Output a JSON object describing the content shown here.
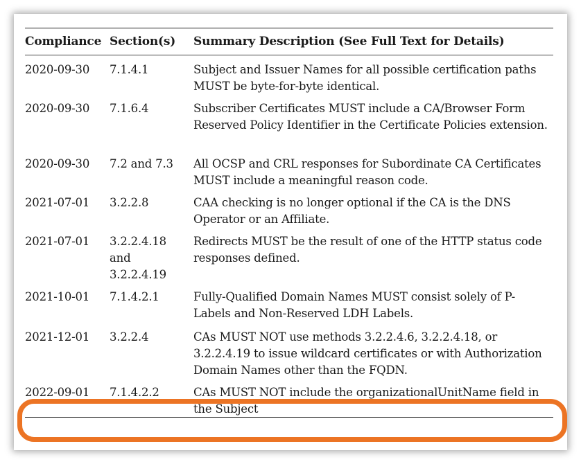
{
  "table": {
    "headers": [
      "Compliance",
      "Section(s)",
      "Summary Description (See Full Text for Details)"
    ],
    "rows": [
      {
        "date": "2020-09-30",
        "section": "7.1.4.1",
        "summary": "Subject and Issuer Names for all possible certification paths MUST be byte-for-byte identical."
      },
      {
        "date": "2020-09-30",
        "section": "7.1.6.4",
        "summary": "Subscriber Certificates MUST include a CA/Browser Form Reserved Policy Identifier in the Certificate Policies extension."
      },
      {
        "date": "2020-09-30",
        "section": "7.2 and 7.3",
        "summary": "All OCSP and CRL responses for Subordinate CA Certificates MUST include a meaningful reason code."
      },
      {
        "date": "2021-07-01",
        "section": "3.2.2.8",
        "summary": "CAA checking is no longer optional if the CA is the DNS Operator or an Affiliate."
      },
      {
        "date": "2021-07-01",
        "section": "3.2.2.4.18 and 3.2.2.4.19",
        "summary": "Redirects MUST be the result of one of the HTTP status code responses defined."
      },
      {
        "date": "2021-10-01",
        "section": "7.1.4.2.1",
        "summary": "Fully-Qualified Domain Names MUST consist solely of P-Labels and Non-Reserved LDH Labels."
      },
      {
        "date": "2021-12-01",
        "section": "3.2.2.4",
        "summary": "CAs MUST NOT use methods 3.2.2.4.6, 3.2.2.4.18, or 3.2.2.4.19 to issue wildcard certificates or with Authorization Domain Names other than the FQDN."
      },
      {
        "date": "2022-09-01",
        "section": "7.1.4.2.2",
        "summary": "CAs MUST NOT include the organizationalUnitName field in the Subject"
      }
    ]
  },
  "highlight": {
    "row_index": 7,
    "color": "#ec7424"
  }
}
